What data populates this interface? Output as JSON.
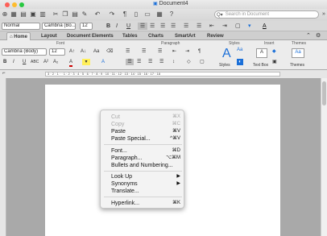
{
  "window": {
    "title": "Document4"
  },
  "toolbar": {
    "search_placeholder": "Search in Document"
  },
  "format": {
    "style": "Normal",
    "font": "Cambria (Bo...",
    "size": "12"
  },
  "ribbon": {
    "tabs": [
      "Home",
      "Layout",
      "Document Elements",
      "Tables",
      "Charts",
      "SmartArt",
      "Review"
    ],
    "groups": {
      "font": "Font",
      "paragraph": "Paragraph",
      "styles": "Styles",
      "insert": "Insert",
      "themes": "Themes"
    },
    "font_box": "Cambria (Body)",
    "size_box": "12",
    "styles_label": "Styles",
    "textbox_label": "Text Box",
    "themes_label": "Themes"
  },
  "ruler": {
    "numbers": "3 · 2 · 1 · · 1 · 2 · 3 · 4 · 5 · 6 · 7 · 8 · 9 · 10 · 11 · 12 · 13 · 14 · 15 · 16 · 17 · 18"
  },
  "menu": {
    "cut": {
      "label": "Cut",
      "shortcut": "⌘X"
    },
    "copy": {
      "label": "Copy",
      "shortcut": "⌘C"
    },
    "paste": {
      "label": "Paste",
      "shortcut": "⌘V"
    },
    "paste_special": {
      "label": "Paste Special...",
      "shortcut": "^⌘V"
    },
    "font": {
      "label": "Font...",
      "shortcut": "⌘D"
    },
    "paragraph": {
      "label": "Paragraph...",
      "shortcut": "⌥⌘M"
    },
    "bullets": {
      "label": "Bullets and Numbering..."
    },
    "lookup": {
      "label": "Look Up",
      "arrow": "▶"
    },
    "synonyms": {
      "label": "Synonyms",
      "arrow": "▶"
    },
    "translate": {
      "label": "Translate..."
    },
    "hyperlink": {
      "label": "Hyperlink...",
      "shortcut": "⌘K"
    }
  },
  "colors": {
    "accent": "#1a6fd8",
    "menu_bg": "#f3f3f3",
    "doc_bg": "#a9a9a9"
  }
}
